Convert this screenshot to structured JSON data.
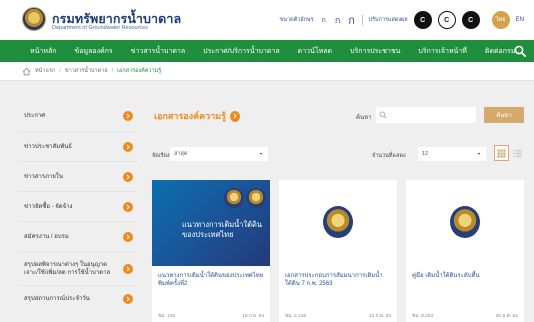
{
  "header": {
    "title": "กรมทรัพยากรน้ำบาดาล",
    "subtitle": "Department of Groundwater Resources",
    "font_size_label": "ขนาดตัวอักษร",
    "font_sizes": [
      "ก",
      "ก",
      "ก"
    ],
    "contrast_label": "ปรับการแสดงผล",
    "contrast_options": [
      "C",
      "C",
      "C"
    ],
    "lang_th": "ไทย",
    "lang_en": "EN"
  },
  "nav": {
    "items": [
      "หน้าหลัก",
      "ข้อมูลองค์กร",
      "ข่าวสารน้ำบาดาล",
      "ประกาศ/บริการน้ำบาดาล",
      "ดาวน์โหลด",
      "บริการประชาชน",
      "บริการเจ้าหน้าที่",
      "ติดต่อกรม"
    ]
  },
  "breadcrumb": {
    "home": "หน้าแรก",
    "level1": "ข่าวสารน้ำบาดาล",
    "current": "เอกสารองค์ความรู้"
  },
  "sidebar": {
    "items": [
      {
        "label": "ประกาศ"
      },
      {
        "label": "ข่าวประชาสัมพันธ์"
      },
      {
        "label": "ข่าวสารภายใน"
      },
      {
        "label": "ข่าวจัดซื้อ - จัดจ้าง"
      },
      {
        "label": "สมัครงาน / อบรม"
      },
      {
        "label": "สรุปผลพิจารณาต่างๆ ในอนุญาต เจาะ/ใช้/เพิ่ม/ลด การใช้น้ำบาดาล"
      },
      {
        "label": "สรุปสถานการณ์ประจำวัน"
      }
    ]
  },
  "main": {
    "title": "เอกสารองค์ความรู้",
    "search_label": "ค้นหา",
    "search_placeholder": "",
    "search_button": "ค้นหา",
    "filter_label": "จัดเรียง",
    "filter_value": "ล่าสุด",
    "count_label": "จำนวนที่แสดง",
    "count_value": "12"
  },
  "cards": [
    {
      "image_text": "แนวทางการเติมน้ำใต้ดินของประเทศไทย",
      "title": "แนวทางการเติมน้ำใต้ดินของประเทศไทย พิมพ์ครั้งที่2",
      "views": "ชม. 138",
      "date": "18 ก.ย. 64"
    },
    {
      "image_text": "",
      "title": "เอกสารประกอบการสัมมนาการเติมน้ำใต้ดิน 7 ก.พ. 2563",
      "views": "ชม. 2,148",
      "date": "12 ก.พ. 63"
    },
    {
      "image_text": "",
      "title": "คู่มือ เติมน้ำใต้ดินระดับตื้น",
      "views": "ชม. 8,323",
      "date": "25 ม.ค. 62"
    }
  ],
  "colors": {
    "nav_green": "#1f8f3e",
    "accent_orange": "#f08a1e",
    "brand_blue": "#1d3b78",
    "button_gold": "#d6aa6c"
  }
}
